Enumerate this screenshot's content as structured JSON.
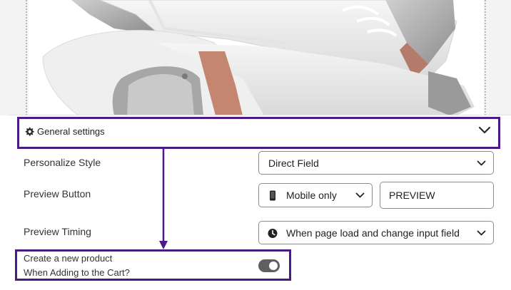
{
  "general_settings": {
    "title": "General settings",
    "icon": "gear-icon",
    "expand_icon": "chevron-down-icon"
  },
  "personalize_style": {
    "label": "Personalize Style",
    "value": "Direct Field"
  },
  "preview_button": {
    "label": "Preview Button",
    "device": "Mobile only",
    "device_icon": "mobile-phone-icon",
    "button_text": "PREVIEW"
  },
  "preview_timing": {
    "label": "Preview Timing",
    "value": "When page load and change input field",
    "icon": "clock-icon"
  },
  "create_product": {
    "label_line1": "Create a new product",
    "label_line2": "When Adding to the Cart?",
    "enabled": true
  },
  "colors": {
    "highlight_border": "#4b1a86",
    "toggle_on": "#5f5f5f"
  }
}
